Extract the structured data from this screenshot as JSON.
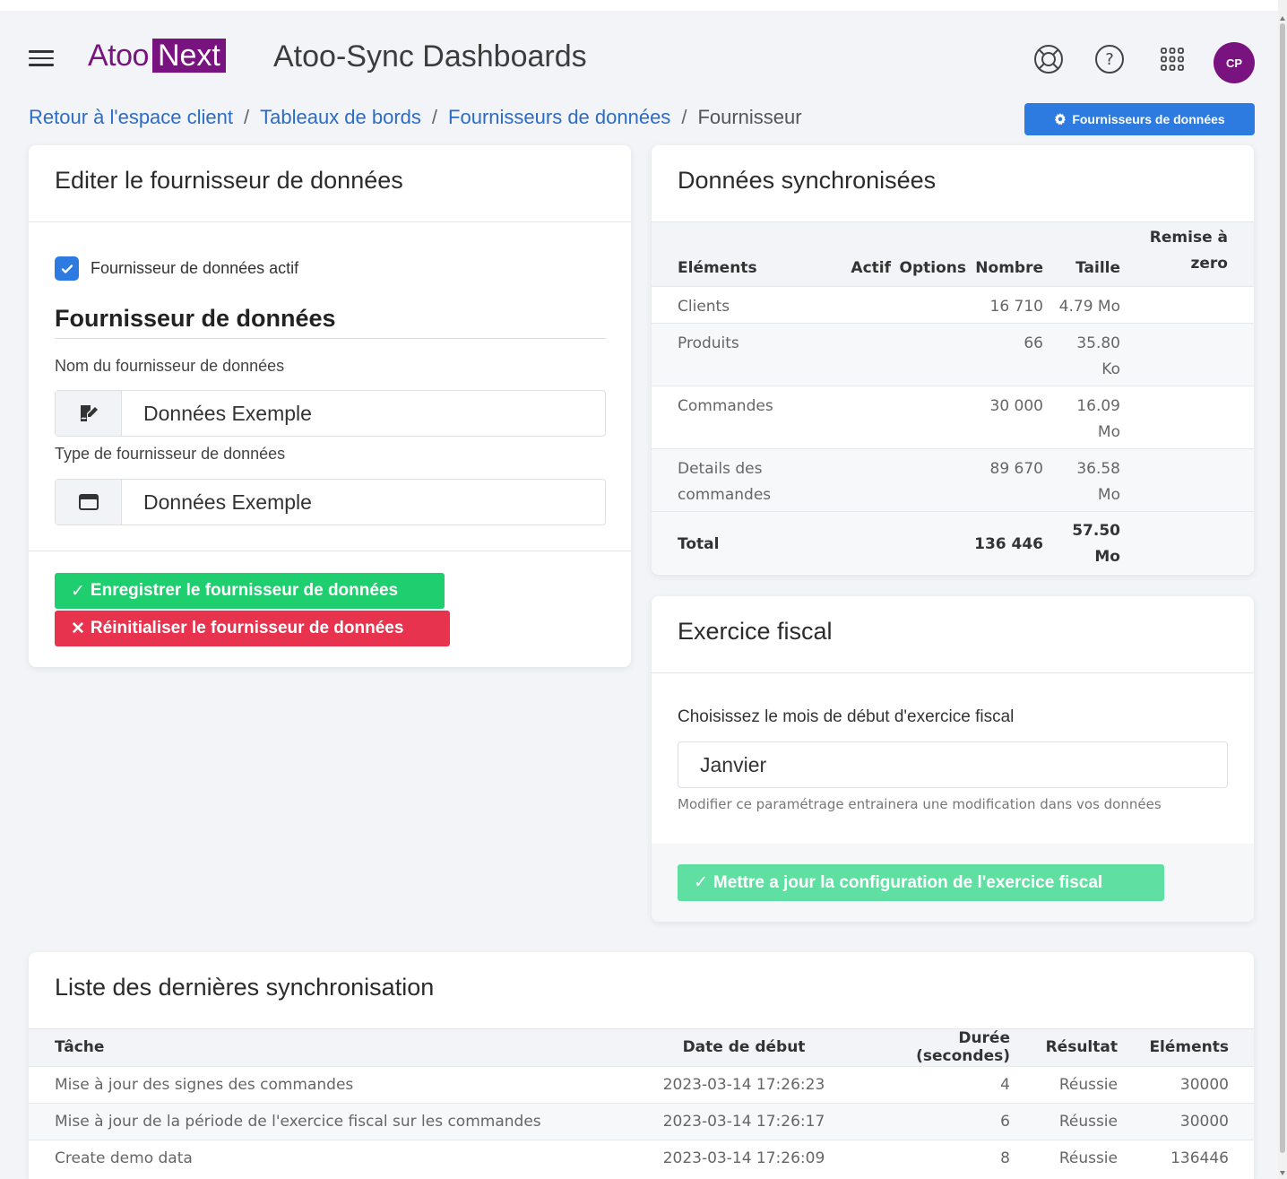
{
  "header": {
    "logo_atoo": "Atoo",
    "logo_next": "Next",
    "app_title": "Atoo-Sync Dashboards",
    "avatar_initials": "CP"
  },
  "breadcrumb": {
    "items": [
      "Retour à l'espace client",
      "Tableaux de bords",
      "Fournisseurs de données"
    ],
    "current": "Fournisseur",
    "separator": "/"
  },
  "providers_button": {
    "label": "Fournisseurs de données"
  },
  "edit_card": {
    "title": "Editer le fournisseur de données",
    "active_label": "Fournisseur de données actif",
    "section_title": "Fournisseur de données",
    "name_label": "Nom du fournisseur de données",
    "name_value": "Données Exemple",
    "type_label": "Type de fournisseur de données",
    "type_value": "Données Exemple",
    "save_label": "Enregistrer le fournisseur de données",
    "reset_label": "Réinitialiser le fournisseur de données"
  },
  "sync_card": {
    "title": "Données synchronisées",
    "columns": [
      "Eléments",
      "Actif",
      "Options",
      "Nombre",
      "Taille",
      "Remise à zero"
    ],
    "rows": [
      {
        "element": "Clients",
        "actif": "",
        "options": "",
        "nombre": "16 710",
        "taille": "4.79 Mo",
        "remise": ""
      },
      {
        "element": "Produits",
        "actif": "",
        "options": "",
        "nombre": "66",
        "taille": "35.80 Ko",
        "remise": ""
      },
      {
        "element": "Commandes",
        "actif": "",
        "options": "",
        "nombre": "30 000",
        "taille": "16.09 Mo",
        "remise": ""
      },
      {
        "element": "Details des commandes",
        "actif": "",
        "options": "",
        "nombre": "89 670",
        "taille": "36.58 Mo",
        "remise": ""
      }
    ],
    "total": {
      "label": "Total",
      "nombre": "136 446",
      "taille": "57.50 Mo"
    }
  },
  "fiscal_card": {
    "title": "Exercice fiscal",
    "label": "Choisissez le mois de début d'exercice fiscal",
    "selected_month": "Janvier",
    "help": "Modifier ce paramétrage entrainera une modification dans vos données",
    "update_label": "Mettre a jour la configuration de l'exercice fiscal"
  },
  "list_card": {
    "title": "Liste des dernières synchronisation",
    "columns": [
      "Tâche",
      "Date de début",
      "Durée (secondes)",
      "Résultat",
      "Eléments"
    ],
    "rows": [
      {
        "task": "Mise à jour des signes des commandes",
        "date": "2023-03-14 17:26:23",
        "duration": "4",
        "result": "Réussie",
        "elements": "30000"
      },
      {
        "task": "Mise à jour de la période de l'exercice fiscal sur les commandes",
        "date": "2023-03-14 17:26:17",
        "duration": "6",
        "result": "Réussie",
        "elements": "30000"
      },
      {
        "task": "Create demo data",
        "date": "2023-03-14 17:26:09",
        "duration": "8",
        "result": "Réussie",
        "elements": "136446"
      }
    ]
  },
  "icons": {
    "menu": "hamburger-icon",
    "support": "lifebuoy-icon",
    "help": "question-icon",
    "apps": "grid-icon",
    "providers_button": "gear-icon",
    "name_prefix": "signature-icon",
    "type_prefix": "window-icon",
    "save": "check-icon",
    "reset": "times-icon",
    "update": "check-icon"
  },
  "colors": {
    "brand": "#79137f",
    "primary": "#2d7be0",
    "success": "#1fce6e",
    "danger": "#e8334f",
    "success_disabled": "#5fe0a2"
  }
}
